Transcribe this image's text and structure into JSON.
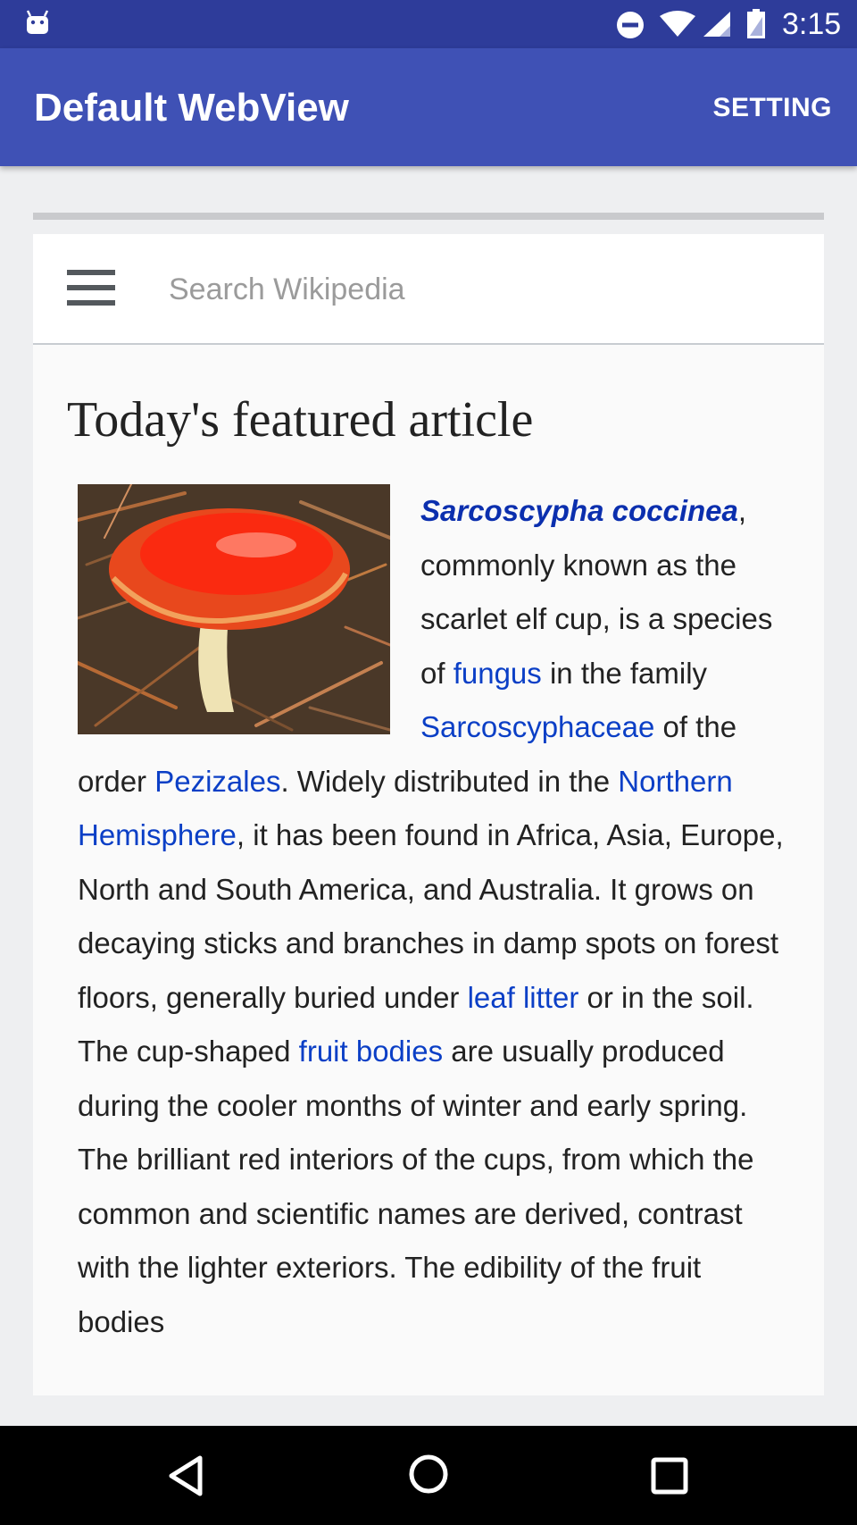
{
  "status_bar": {
    "time": "3:15",
    "icons": [
      "android-icon",
      "do-not-disturb-icon",
      "wifi-icon",
      "signal-icon",
      "battery-icon"
    ]
  },
  "app_bar": {
    "title": "Default WebView",
    "setting_label": "SETTING"
  },
  "wiki": {
    "search_placeholder": "Search Wikipedia",
    "heading": "Today's featured article",
    "image_subject": "scarlet elf cup mushroom photo",
    "article": {
      "lead_link": "Sarcoscypha coccinea",
      "t1": ", commonly known as the scarlet elf cup, is a species of ",
      "link_fungus": "fungus",
      "t2": " in the family ",
      "link_family": "Sarcoscyphaceae",
      "t3": " of the order ",
      "link_order": "Pezizales",
      "t4": ". Widely distributed in the ",
      "link_hemisphere": "Northern Hemisphere",
      "t5": ", it has been found in Africa, Asia, Europe, North and South America, and Australia. It grows on decaying sticks and branches in damp spots on forest floors, generally buried under ",
      "link_leaf_litter": "leaf litter",
      "t6": " or in the soil. The cup-shaped ",
      "link_fruit_bodies": "fruit bodies",
      "t7": " are usually produced during the cooler months of winter and early spring. The brilliant red interiors of the cups, from which the common and scientific names are derived, contrast with the lighter exteriors. The edibility of the fruit bodies"
    }
  },
  "colors": {
    "status_bar": "#2e3c9a",
    "app_bar": "#3f51b5",
    "link": "#0b3fc6"
  },
  "nav_bar": {
    "buttons": [
      "back-icon",
      "home-icon",
      "recents-icon"
    ]
  }
}
